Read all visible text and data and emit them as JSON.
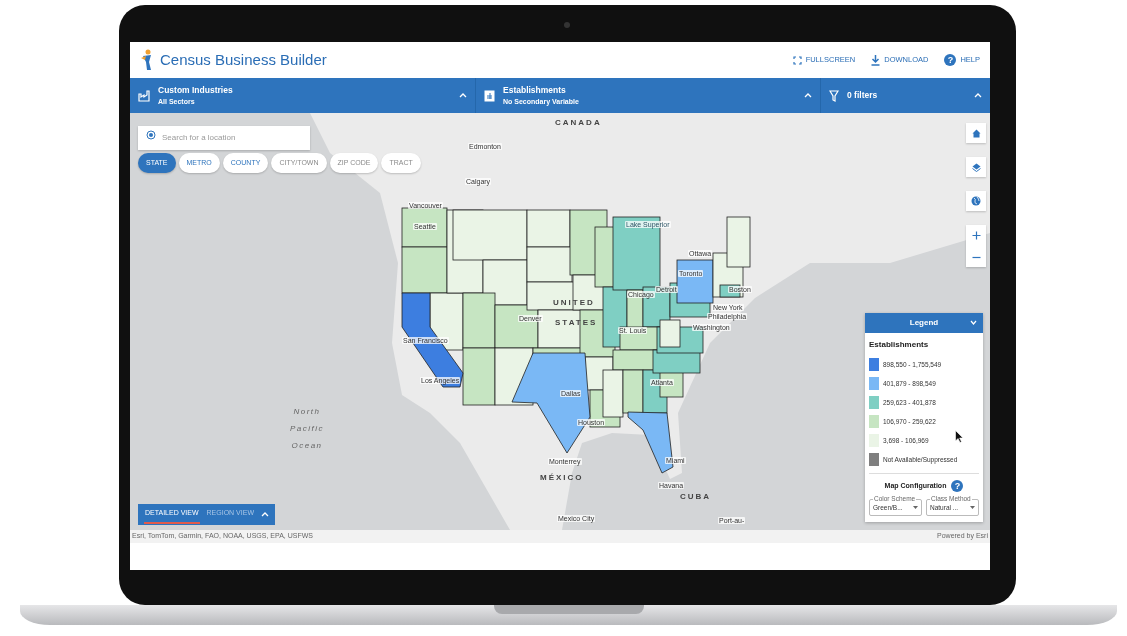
{
  "header": {
    "title": "Census Business Builder",
    "actions": [
      {
        "label": "FULLSCREEN",
        "kind": "fullscreen"
      },
      {
        "label": "DOWNLOAD",
        "kind": "download"
      },
      {
        "label": "HELP",
        "kind": "help",
        "icon": "?"
      }
    ]
  },
  "selector_bar": [
    {
      "kind": "industries",
      "title": "Custom Industries",
      "subtitle": "All Sectors"
    },
    {
      "kind": "variable",
      "title": "Establishments",
      "subtitle": "No Secondary Variable"
    },
    {
      "kind": "filters",
      "title": "0 filters"
    }
  ],
  "search": {
    "placeholder": "Search for a location"
  },
  "geography_levels": [
    {
      "label": "STATE",
      "selected": true,
      "disabled": false
    },
    {
      "label": "METRO",
      "selected": false,
      "disabled": false
    },
    {
      "label": "COUNTY",
      "selected": false,
      "disabled": false
    },
    {
      "label": "CITY/TOWN",
      "selected": false,
      "disabled": true
    },
    {
      "label": "ZIP CODE",
      "selected": false,
      "disabled": true
    },
    {
      "label": "TRACT",
      "selected": false,
      "disabled": true
    }
  ],
  "map_labels": [
    {
      "text": "CANADA",
      "kind": "country"
    },
    {
      "text": "Edmonton",
      "kind": "city"
    },
    {
      "text": "Calgary",
      "kind": "city"
    },
    {
      "text": "Vancouver",
      "kind": "city"
    },
    {
      "text": "Seattle",
      "kind": "city"
    },
    {
      "text": "Ottawa",
      "kind": "city"
    },
    {
      "text": "Toronto",
      "kind": "city"
    },
    {
      "text": "Lake Superior",
      "kind": "lake"
    },
    {
      "text": "Chicago",
      "kind": "city"
    },
    {
      "text": "Detroit",
      "kind": "city"
    },
    {
      "text": "Boston",
      "kind": "city"
    },
    {
      "text": "New York",
      "kind": "city"
    },
    {
      "text": "Philadelphia",
      "kind": "city"
    },
    {
      "text": "Washington",
      "kind": "city"
    },
    {
      "text": "UNITED",
      "kind": "country"
    },
    {
      "text": "STATES",
      "kind": "country"
    },
    {
      "text": "Denver",
      "kind": "city"
    },
    {
      "text": "St. Louis",
      "kind": "city"
    },
    {
      "text": "San Francisco",
      "kind": "city"
    },
    {
      "text": "Los Angeles",
      "kind": "city"
    },
    {
      "text": "Dallas",
      "kind": "city"
    },
    {
      "text": "Houston",
      "kind": "city"
    },
    {
      "text": "Atlanta",
      "kind": "city"
    },
    {
      "text": "Miami",
      "kind": "city"
    },
    {
      "text": "Monterrey",
      "kind": "city"
    },
    {
      "text": "MÉXICO",
      "kind": "country"
    },
    {
      "text": "Havana",
      "kind": "city"
    },
    {
      "text": "CUBA",
      "kind": "country"
    },
    {
      "text": "Mexico City",
      "kind": "city"
    },
    {
      "text": "Port-au-",
      "kind": "city"
    },
    {
      "text": "North Pacific Ocean",
      "kind": "ocean"
    }
  ],
  "legend": {
    "title": "Legend",
    "variable": "Establishments",
    "items": [
      {
        "label": "898,550 - 1,755,549",
        "color": "#3d7ee0"
      },
      {
        "label": "401,879 - 898,549",
        "color": "#7ab8f5"
      },
      {
        "label": "259,623 - 401,878",
        "color": "#7fcfc3"
      },
      {
        "label": "106,970 - 259,622",
        "color": "#c6e5c2"
      },
      {
        "label": "3,698 - 106,969",
        "color": "#eaf4e6"
      },
      {
        "label": "Not Available/Suppressed",
        "color": "#7f7f7f"
      }
    ],
    "config_title": "Map Configuration",
    "config_help": "?",
    "color_scheme": {
      "label": "Color Scheme",
      "value": "Green/B..."
    },
    "class_method": {
      "label": "Class Method",
      "value": "Natural ..."
    }
  },
  "view_toggle": [
    {
      "label": "DETAILED VIEW",
      "selected": true
    },
    {
      "label": "REGION VIEW",
      "selected": false
    }
  ],
  "attribution": "Esri, TomTom, Garmin, FAO, NOAA, USGS, EPA, USFWS",
  "powered_by": "Powered by Esri"
}
